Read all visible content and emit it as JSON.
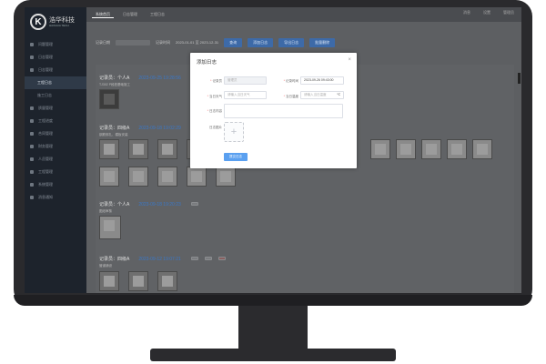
{
  "brand": {
    "name": "浩华科技",
    "sub": "HAOHUA TECH"
  },
  "sidebar": {
    "items": [
      {
        "label": "问题管理",
        "active": false,
        "sub": false
      },
      {
        "label": "日志管理",
        "active": false,
        "sub": false
      },
      {
        "label": "日志管理",
        "active": false,
        "sub": false
      },
      {
        "label": "工程日志",
        "active": true,
        "sub": true
      },
      {
        "label": "施工日志",
        "active": false,
        "sub": true
      },
      {
        "label": "质量管理",
        "active": false,
        "sub": false
      },
      {
        "label": "工程进度",
        "active": false,
        "sub": false
      },
      {
        "label": "合同管理",
        "active": false,
        "sub": false
      },
      {
        "label": "财务管理",
        "active": false,
        "sub": false
      },
      {
        "label": "人员管理",
        "active": false,
        "sub": false
      },
      {
        "label": "工程管理",
        "active": false,
        "sub": false
      },
      {
        "label": "系统管理",
        "active": false,
        "sub": false
      },
      {
        "label": "消息通知",
        "active": false,
        "sub": false
      }
    ]
  },
  "topbar": {
    "crumbs": [
      "系统首页",
      "日志管理",
      "工程日志"
    ],
    "right": [
      "消息",
      "设置",
      "管理员"
    ]
  },
  "filters": {
    "label1": "记录日期",
    "placeholder1": "请输入记录日期",
    "label2": "记录时间",
    "range": "2023-01-01 至 2023-12-31",
    "buttons": [
      "查询",
      "添加日志",
      "导出日志",
      "批量删除"
    ]
  },
  "logs": [
    {
      "head": "记录员：个人A",
      "time": "2023-09-25 19:28:56",
      "desc": "TJ302 P段桩基础施工"
    },
    {
      "head": "记录员：四级A",
      "time": "2023-09-18 19:02:29",
      "desc": "钢筋绑扎、模板安装"
    },
    {
      "head": "记录员：个人A",
      "time": "2023-09-18 19:20:23",
      "desc": "图纸审核"
    },
    {
      "head": "记录员：四级A",
      "time": "2023-09-12 19:07:21",
      "desc": "管道铺设"
    }
  ],
  "dialog": {
    "title": "添加日志",
    "close": "×",
    "fields": {
      "recorder_label": "记录员",
      "recorder_value": "管理员",
      "date_label": "记录时间",
      "date_value": "2023-09-26 09:43:00",
      "weather_label": "当日天气",
      "weather_placeholder": "请输入当日天气",
      "temp_label": "当日温度",
      "temp_placeholder": "请输入当日温度",
      "temp_unit": "℃",
      "content_label": "日志内容",
      "image_label": "日志图片",
      "upload_icon": "+"
    },
    "submit": "提交日志"
  }
}
